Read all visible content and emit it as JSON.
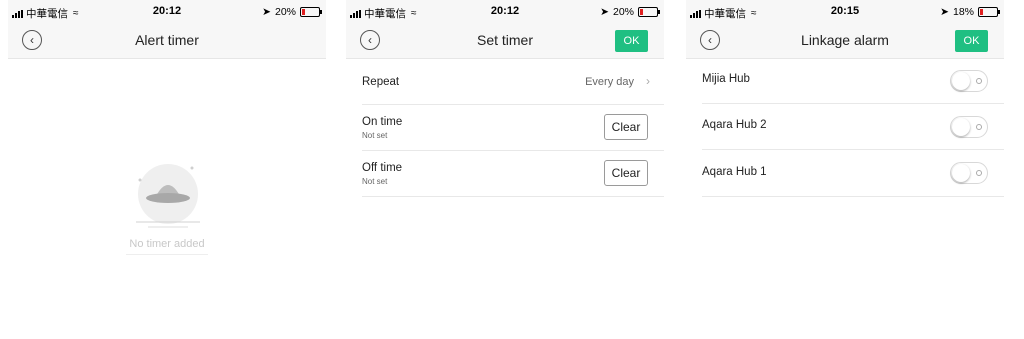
{
  "screens": {
    "alert_timer": {
      "status": {
        "carrier": "中華電信",
        "time": "20:12",
        "battery": "20%",
        "battery_level": 0.2
      },
      "title": "Alert timer",
      "empty_text": "No timer added"
    },
    "set_timer": {
      "status": {
        "carrier": "中華電信",
        "time": "20:12",
        "battery": "20%",
        "battery_level": 0.2
      },
      "title": "Set timer",
      "ok_label": "OK",
      "repeat": {
        "label": "Repeat",
        "value": "Every day"
      },
      "on_time": {
        "label": "On time",
        "sub": "Not set",
        "clear_label": "Clear"
      },
      "off_time": {
        "label": "Off time",
        "sub": "Not set",
        "clear_label": "Clear"
      }
    },
    "linkage_alarm": {
      "status": {
        "carrier": "中華電信",
        "time": "20:15",
        "battery": "18%",
        "battery_level": 0.18
      },
      "title": "Linkage alarm",
      "ok_label": "OK",
      "hubs": [
        {
          "name": "Mijia Hub",
          "enabled": false
        },
        {
          "name": "Aqara Hub 2",
          "enabled": false
        },
        {
          "name": "Aqara Hub 1",
          "enabled": false
        }
      ]
    }
  },
  "colors": {
    "accent": "#1fbf82",
    "battery_low": "#e02020"
  }
}
